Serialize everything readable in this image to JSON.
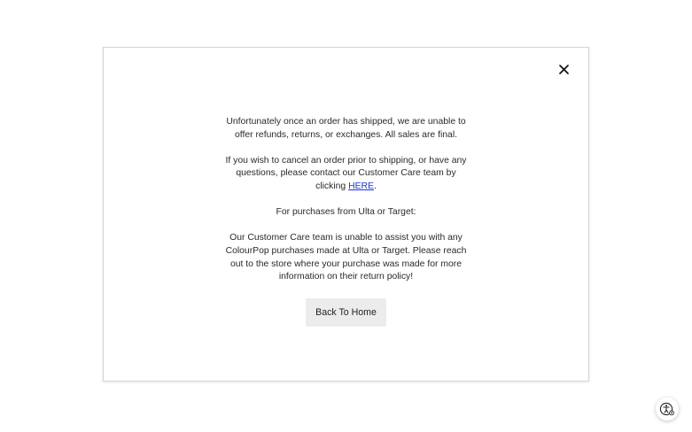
{
  "modal": {
    "close_icon": "close-icon",
    "paragraphs": {
      "p1": "Unfortunately once an order has shipped, we are unable to offer refunds, returns, or exchanges. All sales are final.",
      "p2_before": "If you wish to cancel an order prior to shipping, or have any questions, please contact our Customer Care team by clicking ",
      "p2_link": "HERE",
      "p2_after": ".",
      "p3": "For purchases from Ulta or Target:",
      "p4": "Our Customer Care team is unable to assist you with any ColourPop purchases made at Ulta or Target. Please reach out to the store where your purchase was made for more information on their return policy!"
    },
    "back_button_label": "Back To Home"
  },
  "accessibility": {
    "icon": "accessibility-icon"
  },
  "colors": {
    "link": "#1a35d6",
    "button_bg": "#ececec",
    "modal_border": "#d6d6d6"
  }
}
